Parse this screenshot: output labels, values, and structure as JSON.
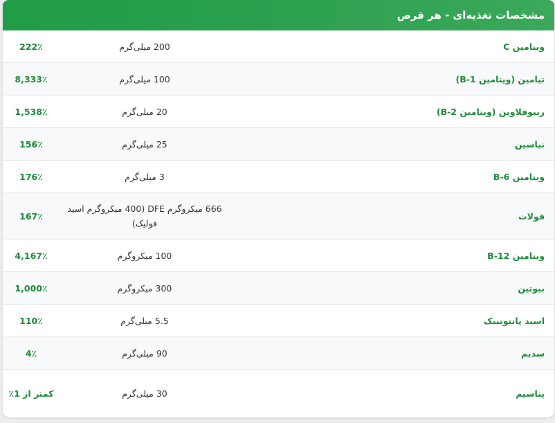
{
  "header": {
    "title": "مشخصات تغذیه‌ای - هر قرص"
  },
  "rows": [
    {
      "name": "ویتامین C",
      "amount": "200 میلی‌گرم",
      "dv": "222٪"
    },
    {
      "name": "تیامین (ویتامین B-1)",
      "amount": "100 میلی‌گرم",
      "dv": "8,333٪"
    },
    {
      "name": "ریبوفلاوین (ویتامین B-2)",
      "amount": "20 میلی‌گرم",
      "dv": "1,538٪"
    },
    {
      "name": "نیاسین",
      "amount": "25 میلی‌گرم",
      "dv": "156٪"
    },
    {
      "name": "ویتامین B-6",
      "amount": "3 میلی‌گرم",
      "dv": "176٪"
    },
    {
      "name": "فولات",
      "amount": "666 میکروگرم DFE (400 میکروگرم اسید فولیک)",
      "dv": "167٪"
    },
    {
      "name": "ویتامین B-12",
      "amount": "100 میکروگرم",
      "dv": "4,167٪"
    },
    {
      "name": "بیوتین",
      "amount": "300 میکروگرم",
      "dv": "1,000٪"
    },
    {
      "name": "اسید پانتوتنیک",
      "amount": "5.5 میلی‌گرم",
      "dv": "110٪"
    },
    {
      "name": "سدیم",
      "amount": "90 میلی‌گرم",
      "dv": "4٪"
    },
    {
      "name": "پتاسیم",
      "amount": "30 میلی‌گرم",
      "dv": "کمتر از 1٪"
    }
  ]
}
